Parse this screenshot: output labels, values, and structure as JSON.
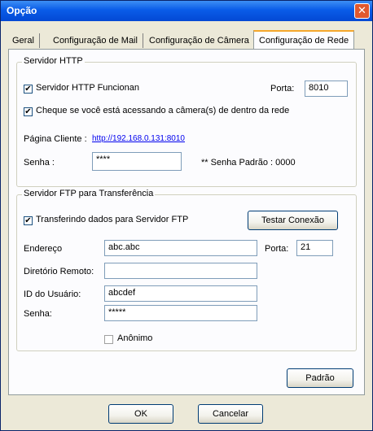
{
  "window": {
    "title": "Opção",
    "close_glyph": "✕"
  },
  "tabs": [
    "Geral",
    "Configuração de Mail",
    "Configuração de Câmera",
    "Configuração de Rede"
  ],
  "http": {
    "legend": "Servidor HTTP",
    "enabled_label": "Servidor HTTP Funcionan",
    "enabled_checked": "✔",
    "port_label": "Porta:",
    "port_value": "8010",
    "local_check_label": "Cheque se você está acessando a câmera(s) de dentro da rede",
    "local_checked": "✔",
    "client_page_label": "Página Cliente :",
    "client_page_url": "http://192.168.0.131:8010",
    "password_label": "Senha :",
    "password_value": "****",
    "default_password_text": "** Senha Padrão : 0000"
  },
  "ftp": {
    "legend": "Servidor FTP para Transferência",
    "transfer_label": "Transferindo dados para Servidor FTP",
    "transfer_checked": "✔",
    "test_button": "Testar Conexão",
    "address_label": "Endereço",
    "address_value": "abc.abc",
    "port_label": "Porta:",
    "port_value": "21",
    "remote_dir_label": "Diretório Remoto:",
    "remote_dir_value": "",
    "user_label": "ID do Usuário:",
    "user_value": "abcdef",
    "password_label": "Senha:",
    "password_value": "*****",
    "anon_label": "Anônimo",
    "anon_checked": ""
  },
  "buttons": {
    "default": "Padrão",
    "ok": "OK",
    "cancel": "Cancelar"
  }
}
